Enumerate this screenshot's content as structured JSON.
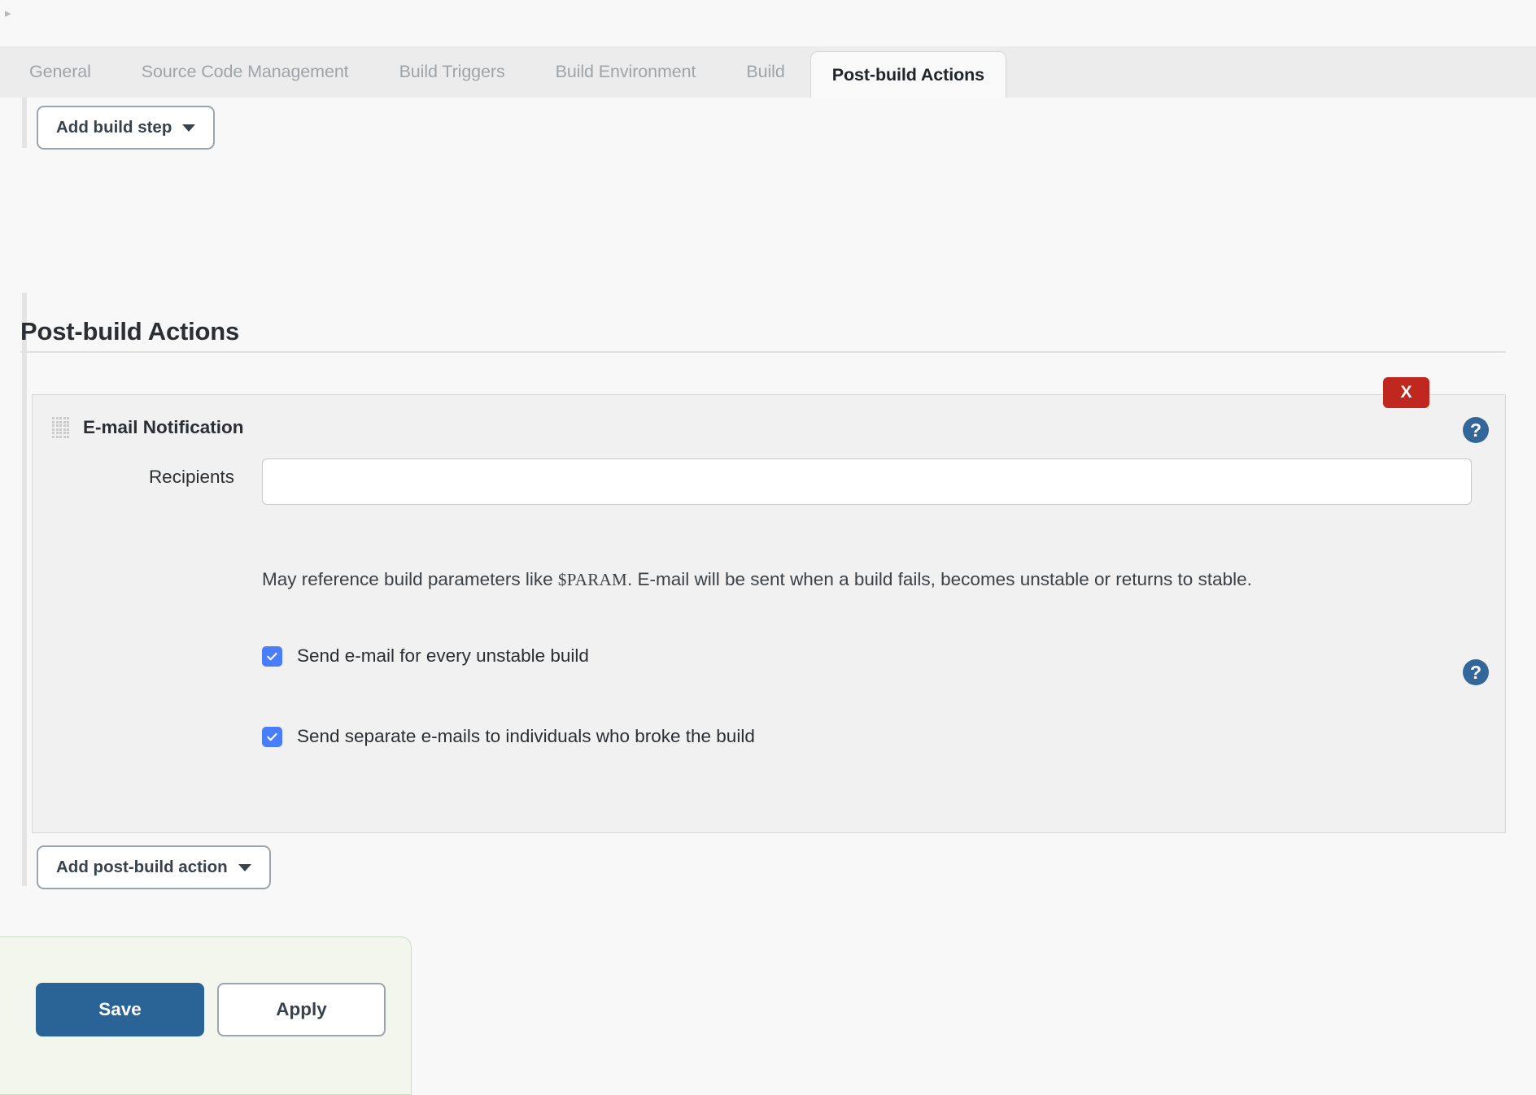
{
  "tabs": [
    {
      "label": "General",
      "active": false
    },
    {
      "label": "Source Code Management",
      "active": false
    },
    {
      "label": "Build Triggers",
      "active": false
    },
    {
      "label": "Build Environment",
      "active": false
    },
    {
      "label": "Build",
      "active": false
    },
    {
      "label": "Post-build Actions",
      "active": true
    }
  ],
  "buttons": {
    "add_build_step": "Add build step",
    "add_post_build_action": "Add post-build action",
    "save": "Save",
    "apply": "Apply"
  },
  "section": {
    "title": "Post-build Actions"
  },
  "panel": {
    "title": "E-mail Notification",
    "delete_label": "X",
    "help_glyph": "?",
    "recipients": {
      "label": "Recipients",
      "value": "",
      "placeholder": ""
    },
    "description_before": "May reference build parameters like ",
    "description_code": "$PARAM",
    "description_after": ". E-mail will be sent when a build fails, becomes unstable or returns to stable.",
    "checkboxes": [
      {
        "label": "Send e-mail for every unstable build",
        "checked": true
      },
      {
        "label": "Send separate e-mails to individuals who broke the build",
        "checked": true
      }
    ]
  },
  "icons": {
    "breadcrumb_caret": "▸",
    "dropdown_caret": "caret-down-icon"
  },
  "colors": {
    "accent_blue": "#2a6496",
    "help_blue": "#336699",
    "checkbox_blue": "#4a7dfc",
    "danger_red": "#c0281f",
    "submit_bar_green": "#f2f6ed"
  }
}
